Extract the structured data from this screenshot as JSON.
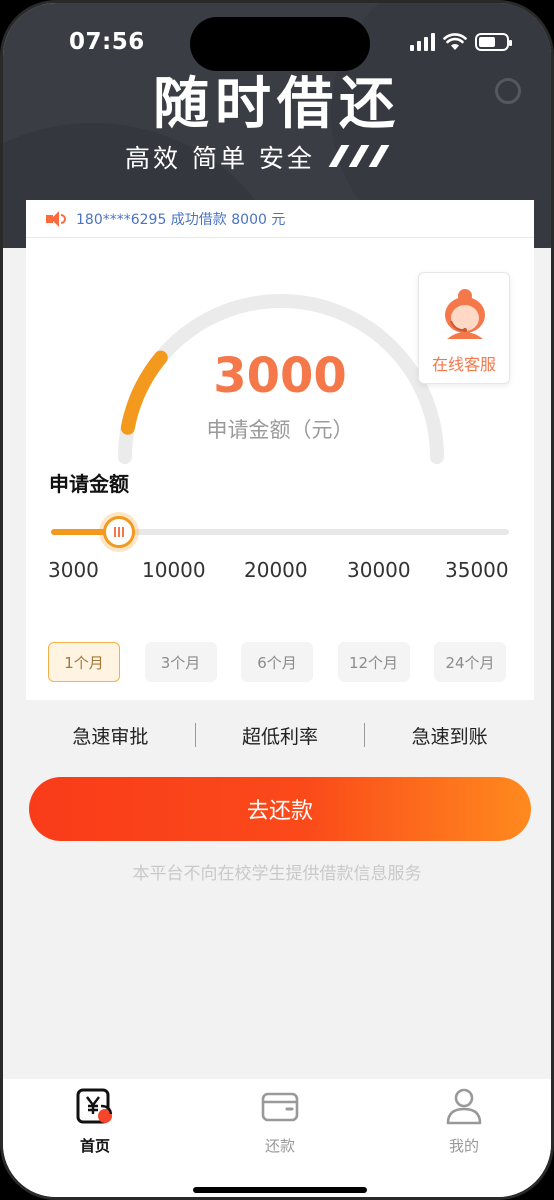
{
  "status": {
    "time": "07:56"
  },
  "hero": {
    "title": "随时借还",
    "subtitle": "高效 简单 安全"
  },
  "notice": {
    "text": "180****6295 成功借款 8000 元"
  },
  "gauge": {
    "amount": "3000",
    "label": "申请金额（元）",
    "progress": 0.03
  },
  "service": {
    "label": "在线客服"
  },
  "amount_section": {
    "title": "申请金额"
  },
  "slider": {
    "min": 3000,
    "max": 35000,
    "value": 6000,
    "ticks": [
      "3000",
      "10000",
      "20000",
      "30000",
      "35000"
    ]
  },
  "periods": [
    {
      "label": "1个月",
      "active": true
    },
    {
      "label": "3个月",
      "active": false
    },
    {
      "label": "6个月",
      "active": false
    },
    {
      "label": "12个月",
      "active": false
    },
    {
      "label": "24个月",
      "active": false
    }
  ],
  "features": [
    "急速审批",
    "超低利率",
    "急速到账"
  ],
  "cta": {
    "label": "去还款"
  },
  "disclaimer": "本平台不向在校学生提供借款信息服务",
  "tabs": [
    {
      "label": "首页",
      "icon": "yen-wallet-icon",
      "active": true
    },
    {
      "label": "还款",
      "icon": "card-icon",
      "active": false
    },
    {
      "label": "我的",
      "icon": "user-icon",
      "active": false
    }
  ],
  "colors": {
    "accent": "#f5784a",
    "slider": "#f39a1e",
    "banner": "#3a3d44",
    "notice": "#4b73c4"
  }
}
